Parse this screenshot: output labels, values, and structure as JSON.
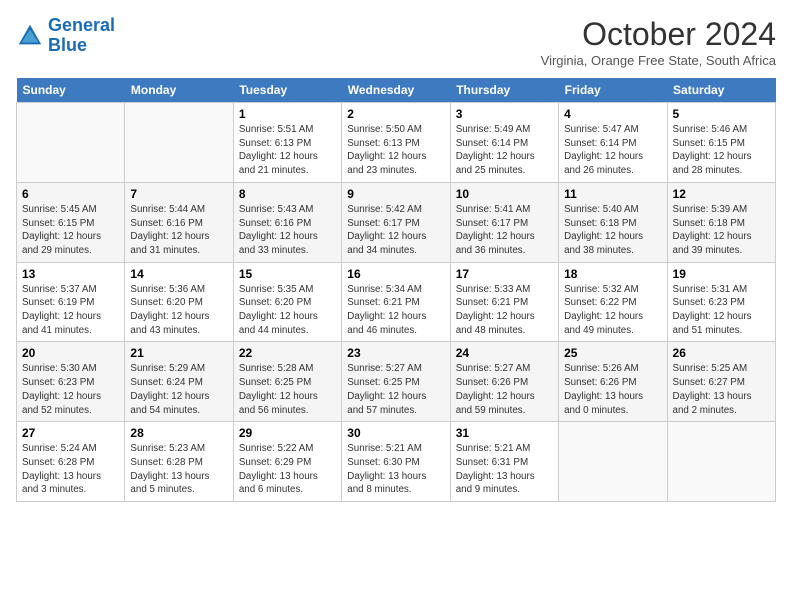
{
  "logo": {
    "line1": "General",
    "line2": "Blue"
  },
  "title": "October 2024",
  "subtitle": "Virginia, Orange Free State, South Africa",
  "weekdays": [
    "Sunday",
    "Monday",
    "Tuesday",
    "Wednesday",
    "Thursday",
    "Friday",
    "Saturday"
  ],
  "weeks": [
    [
      {
        "day": "",
        "info": ""
      },
      {
        "day": "",
        "info": ""
      },
      {
        "day": "1",
        "info": "Sunrise: 5:51 AM\nSunset: 6:13 PM\nDaylight: 12 hours and 21 minutes."
      },
      {
        "day": "2",
        "info": "Sunrise: 5:50 AM\nSunset: 6:13 PM\nDaylight: 12 hours and 23 minutes."
      },
      {
        "day": "3",
        "info": "Sunrise: 5:49 AM\nSunset: 6:14 PM\nDaylight: 12 hours and 25 minutes."
      },
      {
        "day": "4",
        "info": "Sunrise: 5:47 AM\nSunset: 6:14 PM\nDaylight: 12 hours and 26 minutes."
      },
      {
        "day": "5",
        "info": "Sunrise: 5:46 AM\nSunset: 6:15 PM\nDaylight: 12 hours and 28 minutes."
      }
    ],
    [
      {
        "day": "6",
        "info": "Sunrise: 5:45 AM\nSunset: 6:15 PM\nDaylight: 12 hours and 29 minutes."
      },
      {
        "day": "7",
        "info": "Sunrise: 5:44 AM\nSunset: 6:16 PM\nDaylight: 12 hours and 31 minutes."
      },
      {
        "day": "8",
        "info": "Sunrise: 5:43 AM\nSunset: 6:16 PM\nDaylight: 12 hours and 33 minutes."
      },
      {
        "day": "9",
        "info": "Sunrise: 5:42 AM\nSunset: 6:17 PM\nDaylight: 12 hours and 34 minutes."
      },
      {
        "day": "10",
        "info": "Sunrise: 5:41 AM\nSunset: 6:17 PM\nDaylight: 12 hours and 36 minutes."
      },
      {
        "day": "11",
        "info": "Sunrise: 5:40 AM\nSunset: 6:18 PM\nDaylight: 12 hours and 38 minutes."
      },
      {
        "day": "12",
        "info": "Sunrise: 5:39 AM\nSunset: 6:18 PM\nDaylight: 12 hours and 39 minutes."
      }
    ],
    [
      {
        "day": "13",
        "info": "Sunrise: 5:37 AM\nSunset: 6:19 PM\nDaylight: 12 hours and 41 minutes."
      },
      {
        "day": "14",
        "info": "Sunrise: 5:36 AM\nSunset: 6:20 PM\nDaylight: 12 hours and 43 minutes."
      },
      {
        "day": "15",
        "info": "Sunrise: 5:35 AM\nSunset: 6:20 PM\nDaylight: 12 hours and 44 minutes."
      },
      {
        "day": "16",
        "info": "Sunrise: 5:34 AM\nSunset: 6:21 PM\nDaylight: 12 hours and 46 minutes."
      },
      {
        "day": "17",
        "info": "Sunrise: 5:33 AM\nSunset: 6:21 PM\nDaylight: 12 hours and 48 minutes."
      },
      {
        "day": "18",
        "info": "Sunrise: 5:32 AM\nSunset: 6:22 PM\nDaylight: 12 hours and 49 minutes."
      },
      {
        "day": "19",
        "info": "Sunrise: 5:31 AM\nSunset: 6:23 PM\nDaylight: 12 hours and 51 minutes."
      }
    ],
    [
      {
        "day": "20",
        "info": "Sunrise: 5:30 AM\nSunset: 6:23 PM\nDaylight: 12 hours and 52 minutes."
      },
      {
        "day": "21",
        "info": "Sunrise: 5:29 AM\nSunset: 6:24 PM\nDaylight: 12 hours and 54 minutes."
      },
      {
        "day": "22",
        "info": "Sunrise: 5:28 AM\nSunset: 6:25 PM\nDaylight: 12 hours and 56 minutes."
      },
      {
        "day": "23",
        "info": "Sunrise: 5:27 AM\nSunset: 6:25 PM\nDaylight: 12 hours and 57 minutes."
      },
      {
        "day": "24",
        "info": "Sunrise: 5:27 AM\nSunset: 6:26 PM\nDaylight: 12 hours and 59 minutes."
      },
      {
        "day": "25",
        "info": "Sunrise: 5:26 AM\nSunset: 6:26 PM\nDaylight: 13 hours and 0 minutes."
      },
      {
        "day": "26",
        "info": "Sunrise: 5:25 AM\nSunset: 6:27 PM\nDaylight: 13 hours and 2 minutes."
      }
    ],
    [
      {
        "day": "27",
        "info": "Sunrise: 5:24 AM\nSunset: 6:28 PM\nDaylight: 13 hours and 3 minutes."
      },
      {
        "day": "28",
        "info": "Sunrise: 5:23 AM\nSunset: 6:28 PM\nDaylight: 13 hours and 5 minutes."
      },
      {
        "day": "29",
        "info": "Sunrise: 5:22 AM\nSunset: 6:29 PM\nDaylight: 13 hours and 6 minutes."
      },
      {
        "day": "30",
        "info": "Sunrise: 5:21 AM\nSunset: 6:30 PM\nDaylight: 13 hours and 8 minutes."
      },
      {
        "day": "31",
        "info": "Sunrise: 5:21 AM\nSunset: 6:31 PM\nDaylight: 13 hours and 9 minutes."
      },
      {
        "day": "",
        "info": ""
      },
      {
        "day": "",
        "info": ""
      }
    ]
  ]
}
